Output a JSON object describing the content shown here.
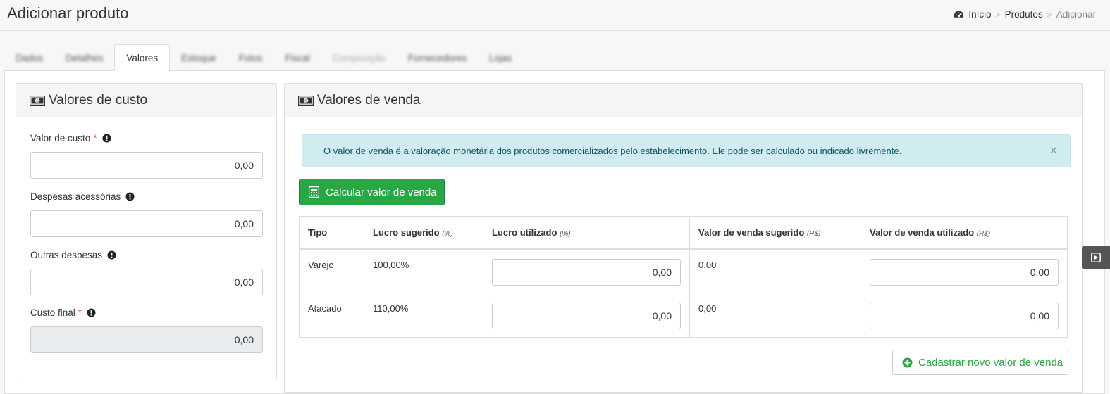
{
  "header": {
    "title": "Adicionar produto",
    "breadcrumb": [
      {
        "label": "Início",
        "icon": "dashboard-icon"
      },
      {
        "label": "Produtos"
      },
      {
        "label": "Adicionar"
      }
    ],
    "separator": ">"
  },
  "tabs": [
    {
      "label": "Dados",
      "blurred": true
    },
    {
      "label": "Detalhes",
      "blurred": true
    },
    {
      "label": "Valores",
      "active": true
    },
    {
      "label": "Estoque",
      "blurred": true
    },
    {
      "label": "Fotos",
      "blurred": true
    },
    {
      "label": "Fiscal",
      "blurred": true
    },
    {
      "label": "Composição",
      "blurred": true,
      "disabled": true
    },
    {
      "label": "Fornecedores",
      "blurred": true
    },
    {
      "label": "Lojas",
      "blurred": true
    }
  ],
  "cost_panel": {
    "title": "Valores de custo",
    "icon": "money-icon",
    "fields": [
      {
        "label": "Valor de custo",
        "required": "*",
        "value": "0,00"
      },
      {
        "label": "Despesas acessórias",
        "value": "0,00"
      },
      {
        "label": "Outras despesas",
        "value": "0,00"
      },
      {
        "label": "Custo final",
        "required": "*",
        "value": "0,00",
        "readonly": true
      }
    ]
  },
  "sale_panel": {
    "title": "Valores de venda",
    "icon": "money-icon",
    "alert_text": "O valor de venda é a valoração monetária dos produtos comercializados pelo estabelecimento. Ele pode ser calculado ou indicado livremente.",
    "alert_close": "×",
    "calc_button": "Calcular valor de venda",
    "table": {
      "headers": [
        {
          "label": "Tipo",
          "unit": ""
        },
        {
          "label": "Lucro sugerido",
          "unit": "(%)"
        },
        {
          "label": "Lucro utilizado",
          "unit": "(%)"
        },
        {
          "label": "Valor de venda sugerido",
          "unit": "(R$)"
        },
        {
          "label": "Valor de venda utilizado",
          "unit": "(R$)"
        }
      ],
      "rows": [
        {
          "tipo": "Varejo",
          "lucro_sugerido": "100,00%",
          "lucro_utilizado": "0,00",
          "venda_sugerido": "0,00",
          "venda_utilizado": "0,00"
        },
        {
          "tipo": "Atacado",
          "lucro_sugerido": "110,00%",
          "lucro_utilizado": "0,00",
          "venda_sugerido": "0,00",
          "venda_utilizado": "0,00"
        }
      ]
    },
    "add_button": "Cadastrar novo valor de venda"
  },
  "colors": {
    "success": "#28a745",
    "alert_bg": "#d1ecf1",
    "required": "#d9534f"
  }
}
